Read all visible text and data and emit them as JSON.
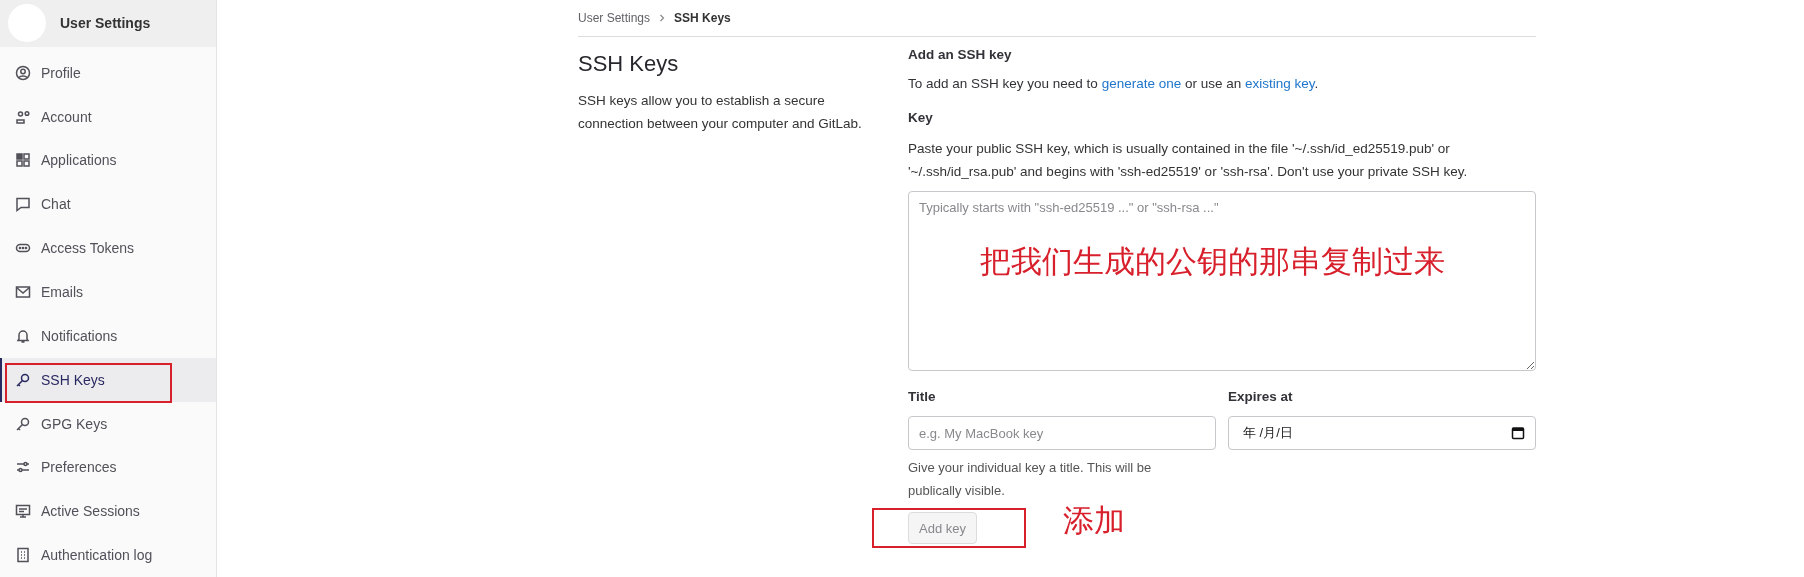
{
  "sidebar": {
    "title": "User Settings",
    "items": [
      {
        "label": "Profile",
        "selected": false,
        "annotated": false
      },
      {
        "label": "Account",
        "selected": false,
        "annotated": false
      },
      {
        "label": "Applications",
        "selected": false,
        "annotated": false
      },
      {
        "label": "Chat",
        "selected": false,
        "annotated": false
      },
      {
        "label": "Access Tokens",
        "selected": false,
        "annotated": false
      },
      {
        "label": "Emails",
        "selected": false,
        "annotated": false
      },
      {
        "label": "Notifications",
        "selected": false,
        "annotated": false
      },
      {
        "label": "SSH Keys",
        "selected": true,
        "annotated": true
      },
      {
        "label": "GPG Keys",
        "selected": false,
        "annotated": false
      },
      {
        "label": "Preferences",
        "selected": false,
        "annotated": false
      },
      {
        "label": "Active Sessions",
        "selected": false,
        "annotated": false
      },
      {
        "label": "Authentication log",
        "selected": false,
        "annotated": false
      }
    ]
  },
  "breadcrumb": [
    "User Settings",
    "SSH Keys"
  ],
  "intro": {
    "title": "SSH Keys",
    "text": "SSH keys allow you to establish a secure connection between your computer and GitLab."
  },
  "form": {
    "heading": "Add an SSH key",
    "lead": [
      "To add an SSH key you need to ",
      "generate one",
      " or use an ",
      "existing key",
      "."
    ],
    "key_label": "Key",
    "key_help": "Paste your public SSH key, which is usually contained in the file '~/.ssh/id_ed25519.pub' or '~/.ssh/id_rsa.pub' and begins with 'ssh-ed25519' or 'ssh-rsa'. Don't use your private SSH key.",
    "key_field": {
      "placeholder": "Typically starts with \"ssh-ed25519 ...\" or \"ssh-rsa ...\"",
      "note": "把我们生成的公钥的那串复制过来"
    },
    "title_label": "Title",
    "title_field": {
      "placeholder": "e.g. My MacBook key"
    },
    "title_help": "Give your individual key a title. This will be publically visible.",
    "expires_label": "Expires at",
    "expires_field": {
      "value": "年 /月/日"
    },
    "add_button": {
      "label": "Add key",
      "disabled": true,
      "annotated": true,
      "note": "添加"
    }
  }
}
